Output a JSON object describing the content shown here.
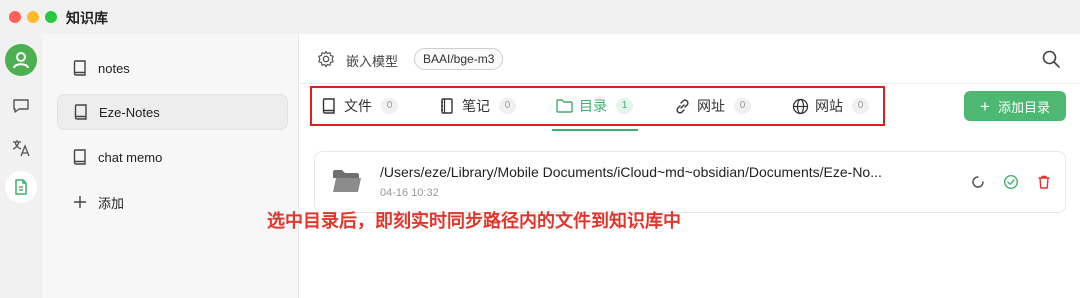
{
  "window": {
    "title": "知识库"
  },
  "colors": {
    "accent": "#3db16b",
    "annotation": "#e0362c",
    "highlight_border": "#e02020"
  },
  "icon_rail": [
    {
      "name": "avatar"
    },
    {
      "name": "chat-icon"
    },
    {
      "name": "translate-icon"
    },
    {
      "name": "knowledge-base-icon"
    }
  ],
  "sidebar": {
    "items": [
      {
        "label": "notes",
        "icon": "book-icon"
      },
      {
        "label": "Eze-Notes",
        "icon": "book-icon",
        "active": true
      },
      {
        "label": "chat memo",
        "icon": "book-icon"
      },
      {
        "label": "添加",
        "icon": "plus-icon"
      }
    ]
  },
  "model_bar": {
    "label": "嵌入模型",
    "model": "BAAI/bge-m3"
  },
  "tabs": [
    {
      "label": "文件",
      "count": "0",
      "icon": "file-icon"
    },
    {
      "label": "笔记",
      "count": "0",
      "icon": "notebook-icon"
    },
    {
      "label": "目录",
      "count": "1",
      "icon": "folder-icon",
      "active": true
    },
    {
      "label": "网址",
      "count": "0",
      "icon": "link-icon"
    },
    {
      "label": "网站",
      "count": "0",
      "icon": "globe-icon"
    }
  ],
  "add_button": {
    "label": "添加目录"
  },
  "directories": [
    {
      "path": "/Users/eze/Library/Mobile Documents/iCloud~md~obsidian/Documents/Eze-No...",
      "time": "04-16 10:32"
    }
  ],
  "annotation": "选中目录后，即刻实时同步路径内的文件到知识库中"
}
